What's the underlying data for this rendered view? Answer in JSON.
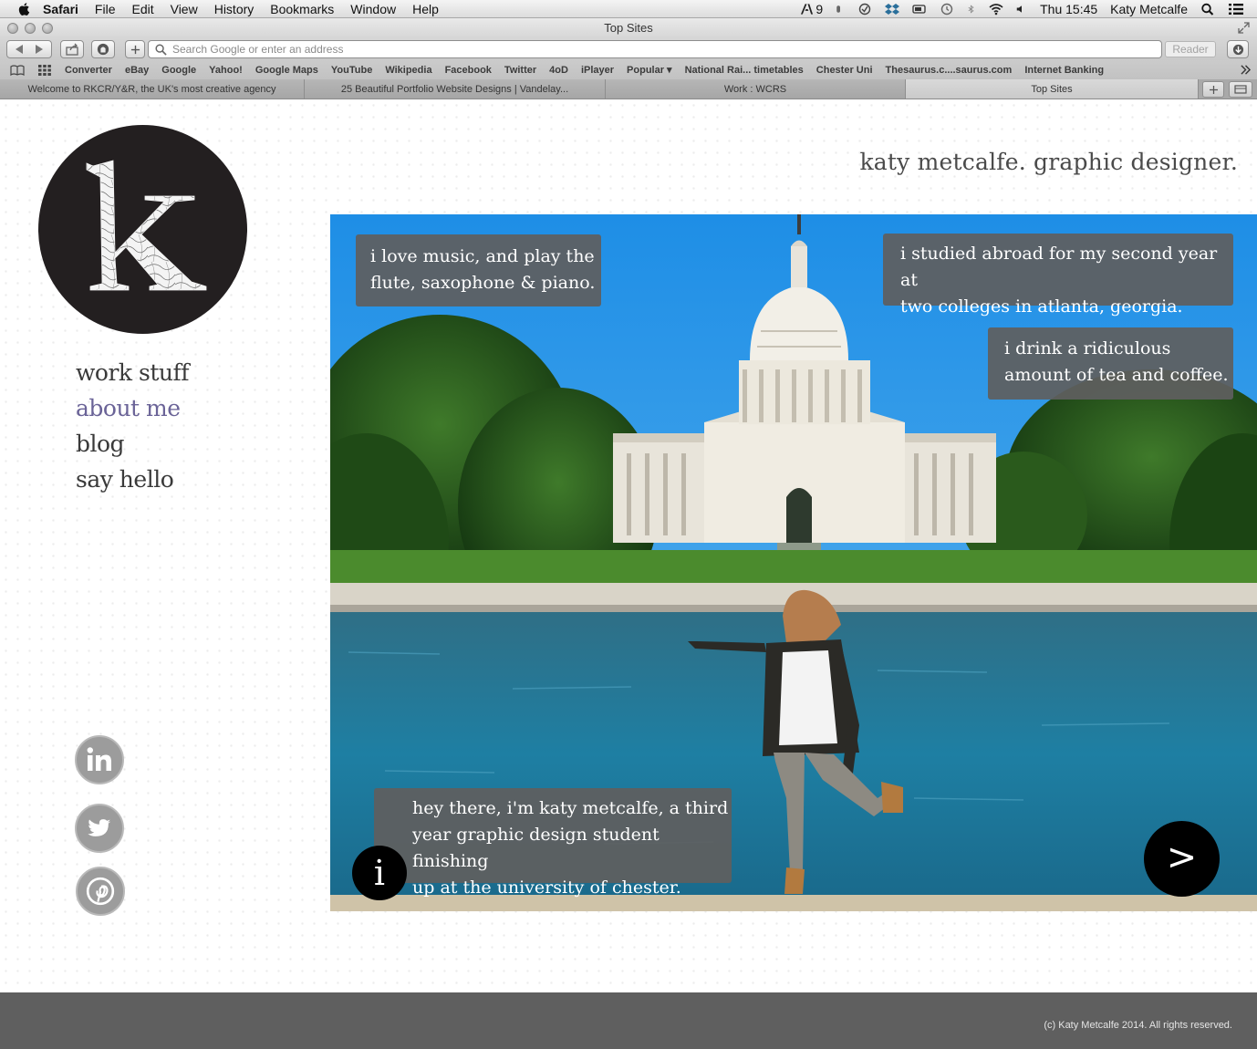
{
  "menubar": {
    "app": "Safari",
    "items": [
      "File",
      "Edit",
      "View",
      "History",
      "Bookmarks",
      "Window",
      "Help"
    ],
    "adobe_count": "9",
    "clock": "Thu 15:45",
    "user": "Katy Metcalfe"
  },
  "window": {
    "title": "Top Sites"
  },
  "toolbar": {
    "search_placeholder": "Search Google or enter an address",
    "reader_label": "Reader"
  },
  "bookmarks": [
    "Converter",
    "eBay",
    "Google",
    "Yahoo!",
    "Google Maps",
    "YouTube",
    "Wikipedia",
    "Facebook",
    "Twitter",
    "4oD",
    "iPlayer",
    "Popular ▾",
    "National Rai... timetables",
    "Chester Uni",
    "Thesaurus.c....saurus.com",
    "Internet Banking"
  ],
  "tabs": [
    "Welcome to RKCR/Y&R, the UK's most creative agency",
    "25 Beautiful Portfolio Website Designs | Vandelay...",
    "Work : WCRS",
    "Top Sites"
  ],
  "site": {
    "logo_letter": "k",
    "tagline": "katy metcalfe. graphic designer.",
    "nav": [
      "work stuff",
      "about me",
      "blog",
      "say hello"
    ],
    "current_nav": "about me",
    "social": [
      "linkedin",
      "twitter",
      "pinterest"
    ],
    "bubbles": {
      "music": [
        "i love music, and play the",
        "flute, saxophone & piano."
      ],
      "abroad": [
        "i studied abroad for my second year at",
        "two colleges in atlanta, georgia."
      ],
      "tea": [
        "i drink a ridiculous",
        "amount of tea and coffee."
      ],
      "intro": [
        "hey there, i'm katy metcalfe, a third",
        "year graphic design student finishing",
        "up at the university of chester."
      ]
    },
    "info_label": "i",
    "next_label": ">",
    "footer": "(c) Katy Metcalfe 2014. All rights reserved."
  },
  "colors": {
    "nav_active": "#6a6397",
    "logo_bg": "#231f20",
    "footer_bg": "#5f5f5f",
    "bubble_bg": "#5f5f5f"
  }
}
